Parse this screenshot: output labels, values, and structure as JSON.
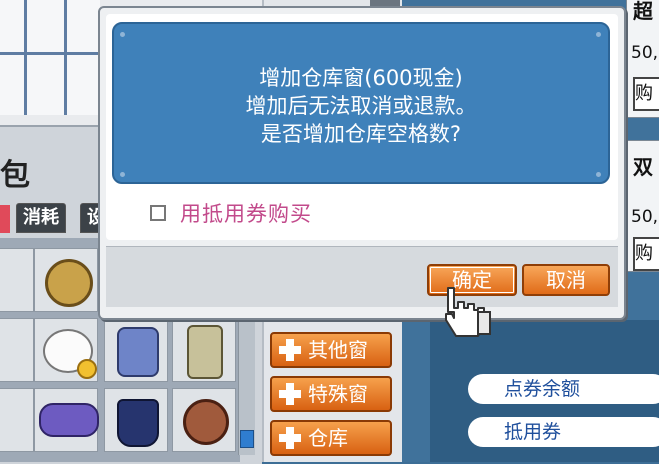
{
  "dialog": {
    "message_lines": [
      "增加仓库窗(600现金)",
      "增加后无法取消或退款。",
      "是否增加仓库空格数?"
    ],
    "checkbox_label": "用抵用券购买",
    "confirm_label": "确定",
    "cancel_label": "取消"
  },
  "inventory": {
    "title_partial": "包",
    "tab_consume": "消耗",
    "tab_partial": "设"
  },
  "side_menu": {
    "items": [
      "其他窗",
      "特殊窗",
      "仓库"
    ]
  },
  "shop": {
    "card1_title_partial": "超",
    "card1_price_partial": "50,",
    "card1_button_partial": "购",
    "card2_title_partial": "双",
    "card2_price_partial": "50,",
    "card2_button_partial": "购",
    "balance_label": "点券余额",
    "voucher_label": "抵用券"
  },
  "colors": {
    "accent_orange": "#e06b18",
    "message_blue": "#3f81ba",
    "checkbox_label_pink": "#c24a8b"
  },
  "icons": [
    "hand-pointer-icon",
    "plus-icon",
    "checkbox-icon"
  ]
}
